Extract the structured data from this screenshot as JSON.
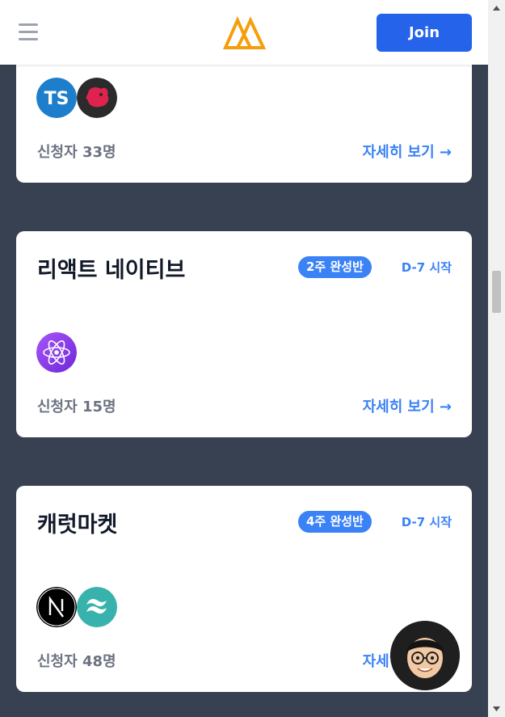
{
  "header": {
    "join_label": "Join"
  },
  "courses": [
    {
      "title": "",
      "badge": "",
      "start": "",
      "stack_icons": [
        "typescript-icon",
        "nestjs-icon"
      ],
      "applicants": "신청자 33명",
      "detail_label": "자세히 보기 →"
    },
    {
      "title": "리액트 네이티브",
      "badge": "2주 완성반",
      "start": "D-7 시작",
      "stack_icons": [
        "react-icon"
      ],
      "applicants": "신청자 15명",
      "detail_label": "자세히 보기 →"
    },
    {
      "title": "캐럿마켓",
      "badge": "4주 완성반",
      "start": "D-7 시작",
      "stack_icons": [
        "nextjs-icon",
        "tailwind-icon"
      ],
      "applicants": "신청자 48명",
      "detail_label": "자세히 보기 →"
    }
  ],
  "colors": {
    "accent": "#2563eb",
    "link": "#3b82f6",
    "background": "#374151",
    "logo": "#f59e0b"
  }
}
